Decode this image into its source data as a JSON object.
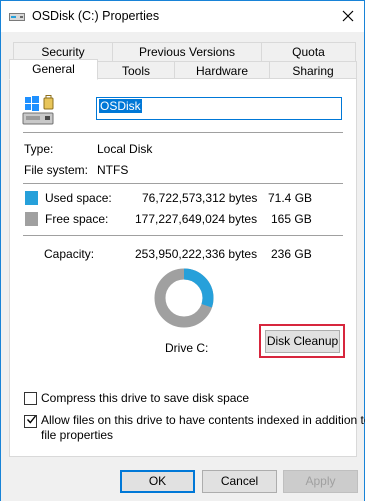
{
  "window": {
    "title": "OSDisk (C:) Properties"
  },
  "tabs": {
    "row1": [
      "Security",
      "Previous Versions",
      "Quota"
    ],
    "row2": [
      "General",
      "Tools",
      "Hardware",
      "Sharing"
    ],
    "active": "General"
  },
  "general": {
    "drive_name": "OSDisk",
    "type_label": "Type:",
    "type_value": "Local Disk",
    "fs_label": "File system:",
    "fs_value": "NTFS",
    "used_label": "Used space:",
    "used_bytes": "76,722,573,312 bytes",
    "used_gb": "71.4 GB",
    "free_label": "Free space:",
    "free_bytes": "177,227,649,024 bytes",
    "free_gb": "165 GB",
    "capacity_label": "Capacity:",
    "capacity_bytes": "253,950,222,336 bytes",
    "capacity_gb": "236 GB",
    "drive_label": "Drive C:",
    "used_fraction": 0.302,
    "cleanup_button": "Disk Cleanup",
    "compress_label": "Compress this drive to save disk space",
    "compress_checked": false,
    "index_label_line1": "Allow files on this drive to have contents indexed in addition to",
    "index_label_line2": "file properties",
    "index_checked": true
  },
  "buttons": {
    "ok": "OK",
    "cancel": "Cancel",
    "apply": "Apply"
  },
  "colors": {
    "used": "#26a0da",
    "free": "#a0a0a0",
    "highlight": "#d7263d",
    "accent": "#0078d7"
  },
  "icons": {
    "title": "drive-icon",
    "close": "close-icon",
    "drive": "windows-drive-icon"
  }
}
